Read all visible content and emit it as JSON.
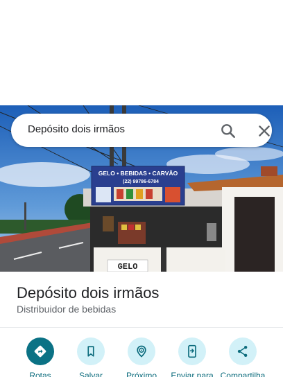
{
  "search": {
    "query": "Depósito dois irmãos",
    "search_icon": "search-icon",
    "close_icon": "close-icon"
  },
  "photo": {
    "sign_title": "GELO • BEBIDAS • CARVÃO",
    "sign_phone": "(22) 99786-6784",
    "counter_sign": "GELO"
  },
  "place": {
    "name": "Depósito dois irmãos",
    "category": "Distribuidor de bebidas"
  },
  "actions": [
    {
      "label": "Rotas",
      "icon": "directions-icon"
    },
    {
      "label": "Salvar",
      "icon": "bookmark-icon"
    },
    {
      "label": "Próximo",
      "icon": "nearby-icon"
    },
    {
      "label": "Enviar para",
      "icon": "send-to-phone-icon"
    },
    {
      "label": "Compartilha",
      "icon": "share-icon"
    }
  ],
  "colors": {
    "primary_action": "#0b7285",
    "action_bg": "#d2f1f8",
    "action_label": "#0b6b7c",
    "sign_blue": "#2a3f8f"
  }
}
